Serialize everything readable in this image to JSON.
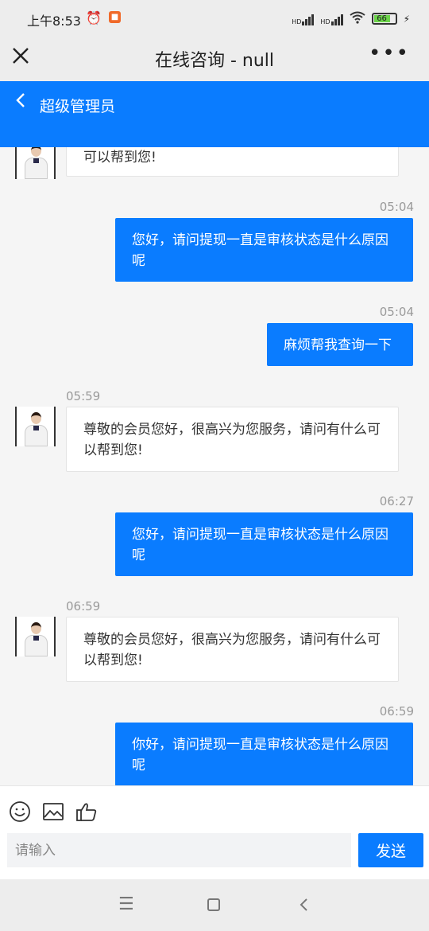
{
  "status_bar": {
    "time": "上午8:53",
    "network1": "HD",
    "network2": "HD",
    "battery": "66"
  },
  "title_bar": {
    "title": "在线咨询 - null"
  },
  "header": {
    "contact_name": "超级管理员"
  },
  "messages": [
    {
      "side": "in",
      "time": "",
      "text": "可以帮到您!"
    },
    {
      "side": "out",
      "time": "05:04",
      "text": "您好，请问提现一直是审核状态是什么原因呢"
    },
    {
      "side": "out",
      "time": "05:04",
      "text": "麻烦帮我查询一下"
    },
    {
      "side": "in",
      "time": "05:59",
      "text": "尊敬的会员您好，很高兴为您服务，请问有什么可以帮到您!"
    },
    {
      "side": "out",
      "time": "06:27",
      "text": "您好，请问提现一直是审核状态是什么原因呢"
    },
    {
      "side": "in",
      "time": "06:59",
      "text": "尊敬的会员您好，很高兴为您服务，请问有什么可以帮到您!"
    },
    {
      "side": "out",
      "time": "06:59",
      "text": "你好，请问提现一直是审核状态是什么原因呢"
    }
  ],
  "input": {
    "placeholder": "请输入",
    "value": ""
  },
  "send_label": "发送",
  "toolbar_icons": [
    "smile-icon",
    "image-icon",
    "thumbs-up-icon"
  ],
  "colors": {
    "accent": "#0a7cff",
    "background": "#f5f5f5"
  }
}
